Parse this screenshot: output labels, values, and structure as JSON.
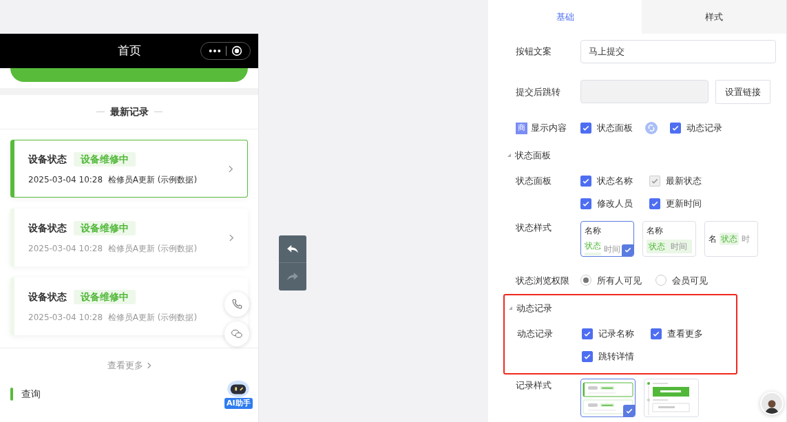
{
  "phone": {
    "title": "首页",
    "record_section": {
      "title": "最新记录",
      "records": [
        {
          "label": "设备状态",
          "status": "设备维修中",
          "meta": "2025-03-04 10:28  检修员A更新 (示例数据)",
          "selected": true
        },
        {
          "label": "设备状态",
          "status": "设备维修中",
          "meta": "2025-03-04 10:28  检修员A更新 (示例数据)",
          "selected": false
        },
        {
          "label": "设备状态",
          "status": "设备维修中",
          "meta": "2025-03-04 10:28  检修员A更新 (示例数据)",
          "selected": false
        }
      ],
      "more": "查看更多"
    },
    "query": "查询",
    "assistant": "AI助手"
  },
  "history": {
    "undo_disabled": false,
    "redo_disabled": true
  },
  "settings": {
    "tabs": [
      {
        "label": "基础",
        "selected": true
      },
      {
        "label": "样式",
        "selected": false
      }
    ],
    "button_text": {
      "label": "按钮文案",
      "value": "马上提交"
    },
    "redirect": {
      "label": "提交后跳转",
      "button": "设置链接"
    },
    "display": {
      "badge": "商",
      "label": "显示内容",
      "options": [
        {
          "label": "状态面板",
          "checked": true
        },
        {
          "label": "动态记录",
          "checked": true
        }
      ]
    },
    "status_panel": {
      "title": "状态面板",
      "fields_label": "状态面板",
      "fields": [
        {
          "label": "状态名称",
          "checked": true,
          "disabled": false
        },
        {
          "label": "最新状态",
          "checked": true,
          "disabled": true
        },
        {
          "label": "修改人员",
          "checked": true,
          "disabled": false
        },
        {
          "label": "更新时间",
          "checked": true,
          "disabled": false
        }
      ],
      "style_label": "状态样式",
      "styles": [
        {
          "kind": "stacked",
          "name": "名称",
          "status": "状态",
          "time": "时间",
          "selected": true
        },
        {
          "kind": "banded",
          "name": "名称",
          "status": "状态",
          "time": "时间",
          "selected": false
        },
        {
          "kind": "inline",
          "name": "名",
          "status": "状态",
          "time": "时",
          "selected": false
        }
      ],
      "permission_label": "状态浏览权限",
      "permissions": [
        {
          "label": "所有人可见",
          "selected": true
        },
        {
          "label": "会员可见",
          "selected": false
        }
      ]
    },
    "dynamic_records": {
      "title": "动态记录",
      "highlighted": true,
      "fields_label": "动态记录",
      "fields": [
        {
          "label": "记录名称",
          "checked": true,
          "disabled": false
        },
        {
          "label": "查看更多",
          "checked": true,
          "disabled": false
        },
        {
          "label": "跳转详情",
          "checked": true,
          "disabled": false
        }
      ]
    },
    "record_style": {
      "label": "记录样式",
      "styles": [
        {
          "kind": "cards",
          "selected": true
        },
        {
          "kind": "timeline",
          "selected": false
        }
      ]
    }
  }
}
